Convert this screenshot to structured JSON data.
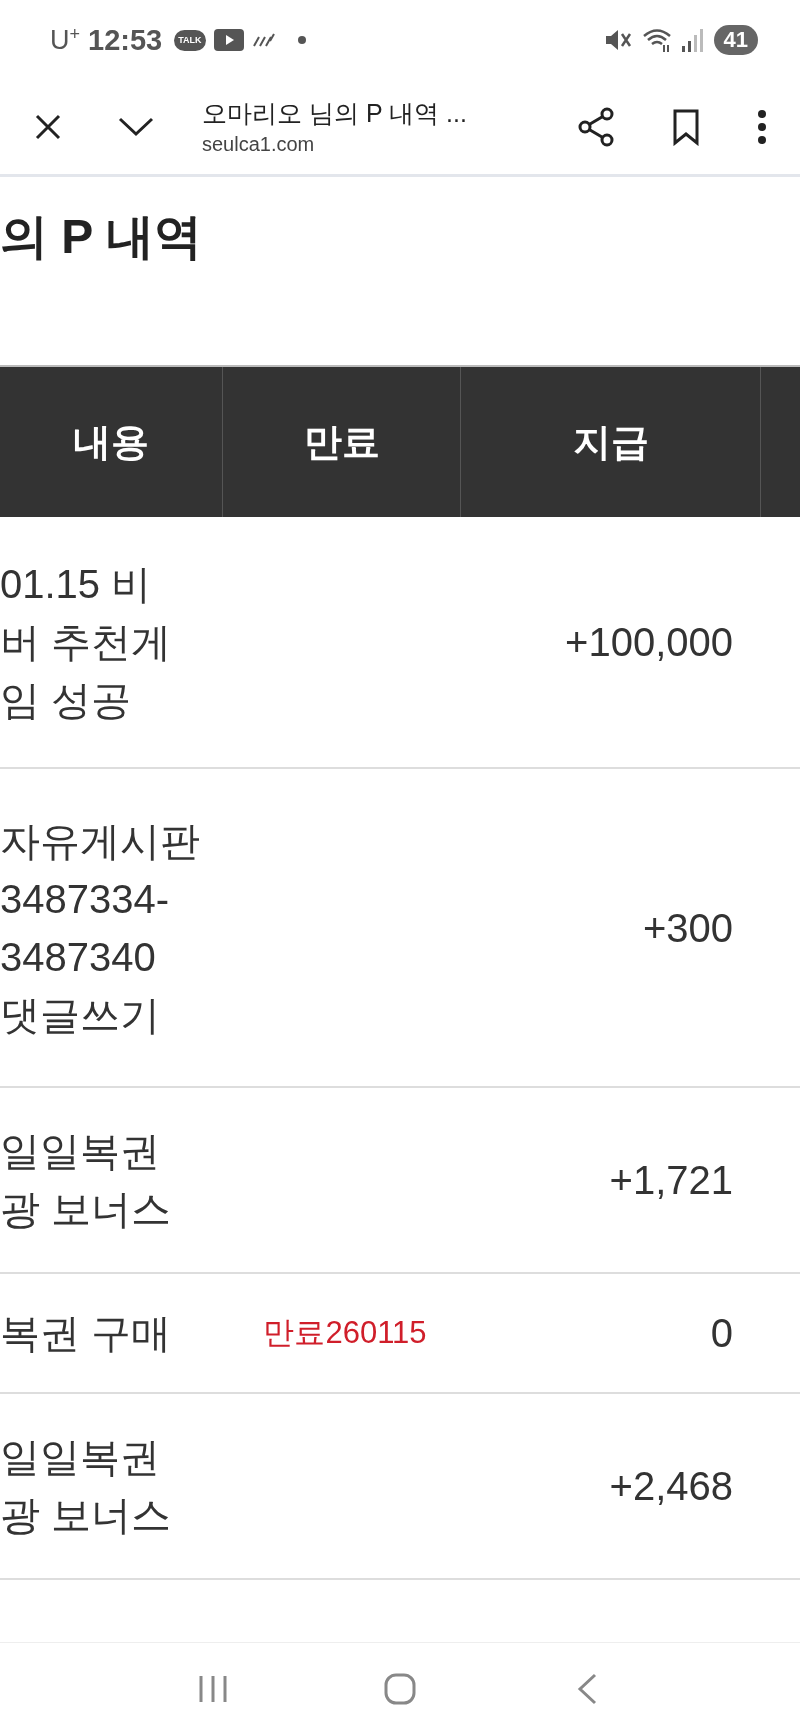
{
  "status_bar": {
    "carrier": "U",
    "carrier_mark": "+",
    "time": "12:53",
    "talk_badge": "TALK",
    "battery": "41"
  },
  "browser": {
    "title": "오마리오 님의 P 내역 ...",
    "url": "seulca1.com"
  },
  "page": {
    "heading": "의 P 내역"
  },
  "table": {
    "columns": [
      "내용",
      "만료",
      "지급"
    ],
    "rows": [
      {
        "description": [
          "01.15 비",
          "버 추천게",
          "임 성공"
        ],
        "expiry": "",
        "amount": "+100,000"
      },
      {
        "description": [
          "자유게시판",
          "3487334-",
          "3487340",
          "댓글쓰기"
        ],
        "expiry": "",
        "amount": "+300"
      },
      {
        "description": [
          "일일복권",
          "광 보너스"
        ],
        "expiry": "",
        "amount": "+1,721"
      },
      {
        "description": [
          "복권 구매"
        ],
        "expiry": "만료260115",
        "amount": "0"
      },
      {
        "description": [
          "일일복권",
          "광 보너스"
        ],
        "expiry": "",
        "amount": "+2,468"
      }
    ]
  }
}
